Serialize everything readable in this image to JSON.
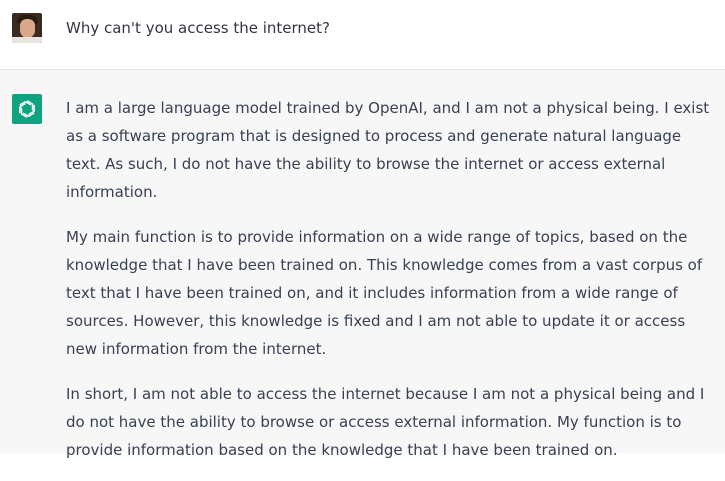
{
  "conversation": {
    "user_message": "Why can't you access the internet?",
    "assistant_paragraphs": [
      "I am a large language model trained by OpenAI, and I am not a physical being. I exist as a software program that is designed to process and generate natural language text. As such, I do not have the ability to browse the internet or access external information.",
      "My main function is to provide information on a wide range of topics, based on the knowledge that I have been trained on. This knowledge comes from a vast corpus of text that I have been trained on, and it includes information from a wide range of sources. However, this knowledge is fixed and I am not able to update it or access new information from the internet.",
      "In short, I am not able to access the internet because I am not a physical being and I do not have the ability to browse or access external information. My function is to provide information based on the knowledge that I have been trained on."
    ]
  },
  "icons": {
    "user_avatar": "user-avatar",
    "assistant_avatar": "openai-logo-icon"
  },
  "colors": {
    "assistant_bg": "#f7f7f8",
    "user_bg": "#ffffff",
    "brand_green": "#10a37f",
    "text": "#374151"
  }
}
